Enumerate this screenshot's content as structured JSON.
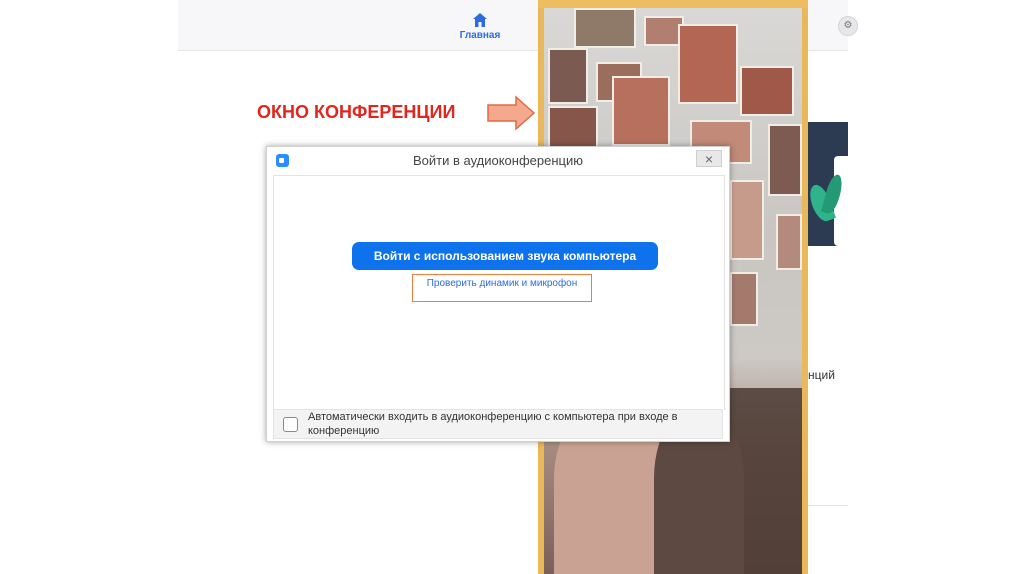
{
  "zoom_main": {
    "home_label": "Главная",
    "side_partial_text": "нций"
  },
  "annotation": {
    "title": "ОКНО КОНФЕРЕНЦИИ"
  },
  "dialog": {
    "title": "Войти в аудиоконференцию",
    "close_symbol": "×",
    "join_button_label": "Войти с использованием звука компьютера",
    "test_link_label": "Проверить динамик и микрофон",
    "auto_join_text": "Автоматически входить в аудиоконференцию с компьютера при входе в конференцию",
    "auto_join_checked": false
  },
  "colors": {
    "accent_blue": "#0e72ed",
    "annotation_red": "#e0261f",
    "arrow_orange": "#ef7d3b",
    "window_border": "#e9b85a"
  }
}
